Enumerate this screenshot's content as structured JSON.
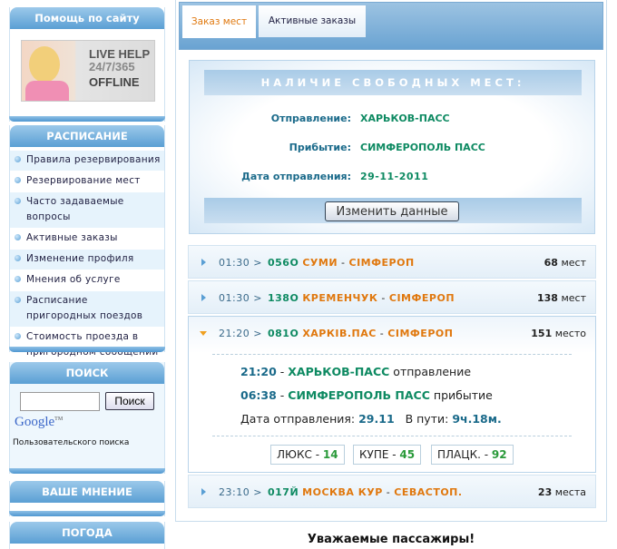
{
  "sidebar": {
    "help": {
      "title": "Помощь по сайту",
      "banner": {
        "line1": "LIVE HELP",
        "line2": "24/7/365",
        "line3": "OFFLINE"
      }
    },
    "schedule": {
      "title": "РАСПИСАНИЕ",
      "items": [
        {
          "label": "Правила резервирования"
        },
        {
          "label": "Резервирование мест"
        },
        {
          "label": "Часто задаваемые вопросы"
        },
        {
          "label": "Активные заказы"
        },
        {
          "label": "Изменение профиля"
        },
        {
          "label": "Мнения об услуге"
        },
        {
          "label": "Расписание пригородных поездов"
        },
        {
          "label": "Стоимость проезда в пригородном сообщении"
        }
      ]
    },
    "search": {
      "title": "ПОИСК",
      "input_value": "",
      "button": "Поиск",
      "google": "Google",
      "google_tm": "TM",
      "caption": "Пользовательского поиска"
    },
    "opinion": {
      "title": "ВАШЕ МНЕНИЕ"
    },
    "weather": {
      "title": "ПОГОДА"
    }
  },
  "tabs": [
    {
      "label": "Заказ мест",
      "active": true
    },
    {
      "label": "Активные заказы",
      "active": false
    }
  ],
  "availability": {
    "title": "НАЛИЧИЕ СВОБОДНЫХ МЕСТ:",
    "departure_label": "Отправление:",
    "departure": "ХАРЬКОВ-ПАСС",
    "arrival_label": "Прибытие:",
    "arrival": "СИМФЕРОПОЛЬ ПАСС",
    "date_label": "Дата отправления:",
    "date": "29-11-2011",
    "change_button": "Изменить данные"
  },
  "trains": [
    {
      "time": "01:30 >",
      "number": "056О",
      "from": "СУМИ",
      "to": "СІМФЕРОП",
      "seats": "68",
      "seats_word": "мест"
    },
    {
      "time": "01:30 >",
      "number": "138О",
      "from": "КРЕМЕНЧУК",
      "to": "СІМФЕРОП",
      "seats": "138",
      "seats_word": "мест"
    },
    {
      "time": "21:20 >",
      "number": "081О",
      "from": "ХАРКІВ.ПАС",
      "to": "СІМФЕРОП",
      "seats": "151",
      "seats_word": "место",
      "expanded": {
        "dep_time": "21:20",
        "dep_station": "ХАРЬКОВ-ПАСС",
        "dep_word": "отправление",
        "arr_time": "06:38",
        "arr_station": "СИМФЕРОПОЛЬ ПАСС",
        "arr_word": "прибытие",
        "date_label": "Дата отправления:",
        "date": "29.11",
        "travel_label": "В пути:",
        "travel": "9ч.18м.",
        "classes": [
          {
            "name": "ЛЮКС",
            "count": "14"
          },
          {
            "name": "КУПЕ",
            "count": "45"
          },
          {
            "name": "ПЛАЦК.",
            "count": "92"
          }
        ]
      }
    },
    {
      "time": "23:10 >",
      "number": "017Й",
      "from": "МОСКВА КУР",
      "to": "СЕВАСТОП.",
      "seats": "23",
      "seats_word": "места"
    }
  ],
  "sep": " - ",
  "notice": "Уважаемые пассажиры!"
}
